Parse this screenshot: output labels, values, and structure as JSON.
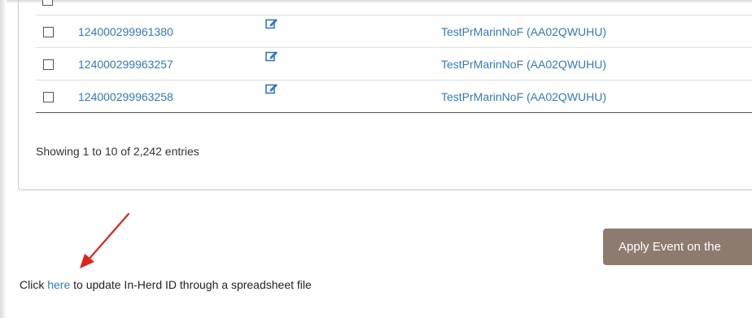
{
  "table": {
    "rows": [
      {
        "id": "124000299961380",
        "name": "TestPrMarinNoF (AA02QWUHU)"
      },
      {
        "id": "124000299963257",
        "name": "TestPrMarinNoF (AA02QWUHU)"
      },
      {
        "id": "124000299963258",
        "name": "TestPrMarinNoF (AA02QWUHU)"
      }
    ],
    "info": "Showing 1 to 10 of 2,242 entries"
  },
  "actions": {
    "apply_label": "Apply Event on the"
  },
  "footer": {
    "prefix": "Click ",
    "link": "here",
    "suffix": " to update In-Herd ID through a spreadsheet file"
  },
  "colors": {
    "link": "#337ab7",
    "apply_button_bg": "#8c7b6e",
    "arrow": "#e2231a"
  },
  "icons": {
    "row_edit": "edit-icon",
    "annotation": "red-arrow"
  }
}
